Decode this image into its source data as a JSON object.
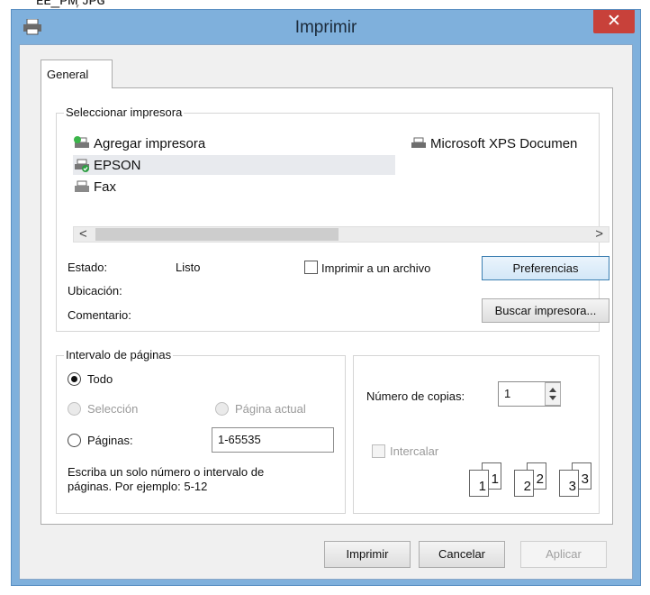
{
  "filename_fragment": "ᴇᴇ_ᴘᴍ᷊ ᴊᴘɢ",
  "window": {
    "title": "Imprimir",
    "close_glyph": "✕"
  },
  "tabs": [
    {
      "label": "General"
    }
  ],
  "select_printer": {
    "group_title": "Seleccionar impresora",
    "printers": [
      {
        "label": "Agregar impresora",
        "icon": "add-printer-icon"
      },
      {
        "label": "EPSON",
        "icon": "printer-default-icon",
        "selected": true
      },
      {
        "label": "Fax",
        "icon": "fax-icon"
      },
      {
        "label": "Microsoft XPS Documen",
        "icon": "printer-icon"
      }
    ],
    "scroll_left": "<",
    "scroll_right": ">",
    "status_label": "Estado:",
    "status_value": "Listo",
    "location_label": "Ubicación:",
    "comment_label": "Comentario:",
    "print_to_file_label": "Imprimir a un archivo",
    "preferences_button": "Preferencias",
    "find_printer_button": "Buscar impresora..."
  },
  "page_range": {
    "group_title": "Intervalo de páginas",
    "all_label": "Todo",
    "selection_label": "Selección",
    "current_page_label": "Página actual",
    "pages_label": "Páginas:",
    "pages_value": "1-65535",
    "hint_line1": "Escriba un solo número o intervalo de",
    "hint_line2": "páginas. Por ejemplo: 5-12",
    "selected_option": "all"
  },
  "copies": {
    "label": "Número de copias:",
    "value": "1",
    "collate_label": "Intercalar",
    "collate_checked": false,
    "collate_pages": [
      "1",
      "1",
      "2",
      "2",
      "3",
      "3"
    ]
  },
  "footer": {
    "print_button": "Imprimir",
    "cancel_button": "Cancelar",
    "apply_button": "Aplicar"
  }
}
